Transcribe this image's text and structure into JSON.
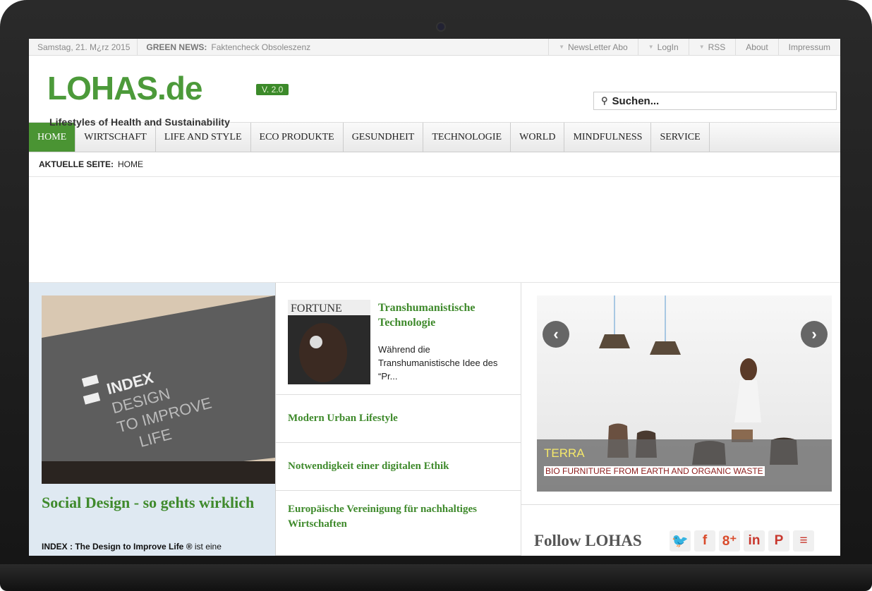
{
  "topbar": {
    "date": "Samstag, 21. M¿rz 2015",
    "news_label": "GREEN NEWS:",
    "news_text": "Faktencheck Obsoleszenz",
    "links": [
      {
        "label": "NewsLetter Abo",
        "arrow": true
      },
      {
        "label": "LogIn",
        "arrow": true
      },
      {
        "label": "RSS",
        "arrow": true
      },
      {
        "label": "About",
        "arrow": false
      },
      {
        "label": "Impressum",
        "arrow": false
      }
    ]
  },
  "header": {
    "logo": "LOHAS.de",
    "tagline": "Lifestyles of Health and Sustainability",
    "version": "V. 2.0",
    "search_placeholder": "Suchen..."
  },
  "nav": [
    "HOME",
    "WIRTSCHAFT",
    "LIFE AND STYLE",
    "ECO PRODUKTE",
    "GESUNDHEIT",
    "TECHNOLOGIE",
    "WORLD",
    "MINDFULNESS",
    "SERVICE"
  ],
  "breadcrumb": {
    "label": "AKTUELLE SEITE:",
    "value": "HOME"
  },
  "featured": {
    "image_text": [
      "INDEX",
      "DESIGN",
      "TO IMPROVE",
      "LIFE"
    ],
    "title": "Social Design - so gehts wirklich",
    "desc_bold": "INDEX : The Design to Improve Life ®",
    "desc_rest": " ist eine"
  },
  "articles": {
    "first": {
      "thumb_text": "FORTUNE",
      "title": "Transhumanistische Technologie",
      "desc": "Während die Transhumanistische Idee des “Pr..."
    },
    "list": [
      "Modern Urban Lifestyle",
      "Notwendigkeit einer digitalen Ethik",
      "Europäische Vereinigung für nachhaltiges Wirtschaften"
    ]
  },
  "slider": {
    "title": "TERRA",
    "subtitle": "BIO FURNITURE FROM EARTH AND ORGANIC WASTE"
  },
  "follow": {
    "label": "Follow LOHAS",
    "icons": [
      {
        "name": "twitter-icon",
        "glyph": "🐦",
        "color": "#2ba0d8"
      },
      {
        "name": "facebook-icon",
        "glyph": "f",
        "color": "#d94a2a"
      },
      {
        "name": "google-plus-icon",
        "glyph": "8⁺",
        "color": "#d94a2a"
      },
      {
        "name": "linkedin-icon",
        "glyph": "in",
        "color": "#c8372d"
      },
      {
        "name": "pinterest-icon",
        "glyph": "P",
        "color": "#c8372d"
      },
      {
        "name": "rss-icon",
        "glyph": "≡",
        "color": "#c8372d"
      }
    ]
  },
  "colors": {
    "brand_green": "#4c9a3a",
    "nav_active": "#4a9433"
  }
}
